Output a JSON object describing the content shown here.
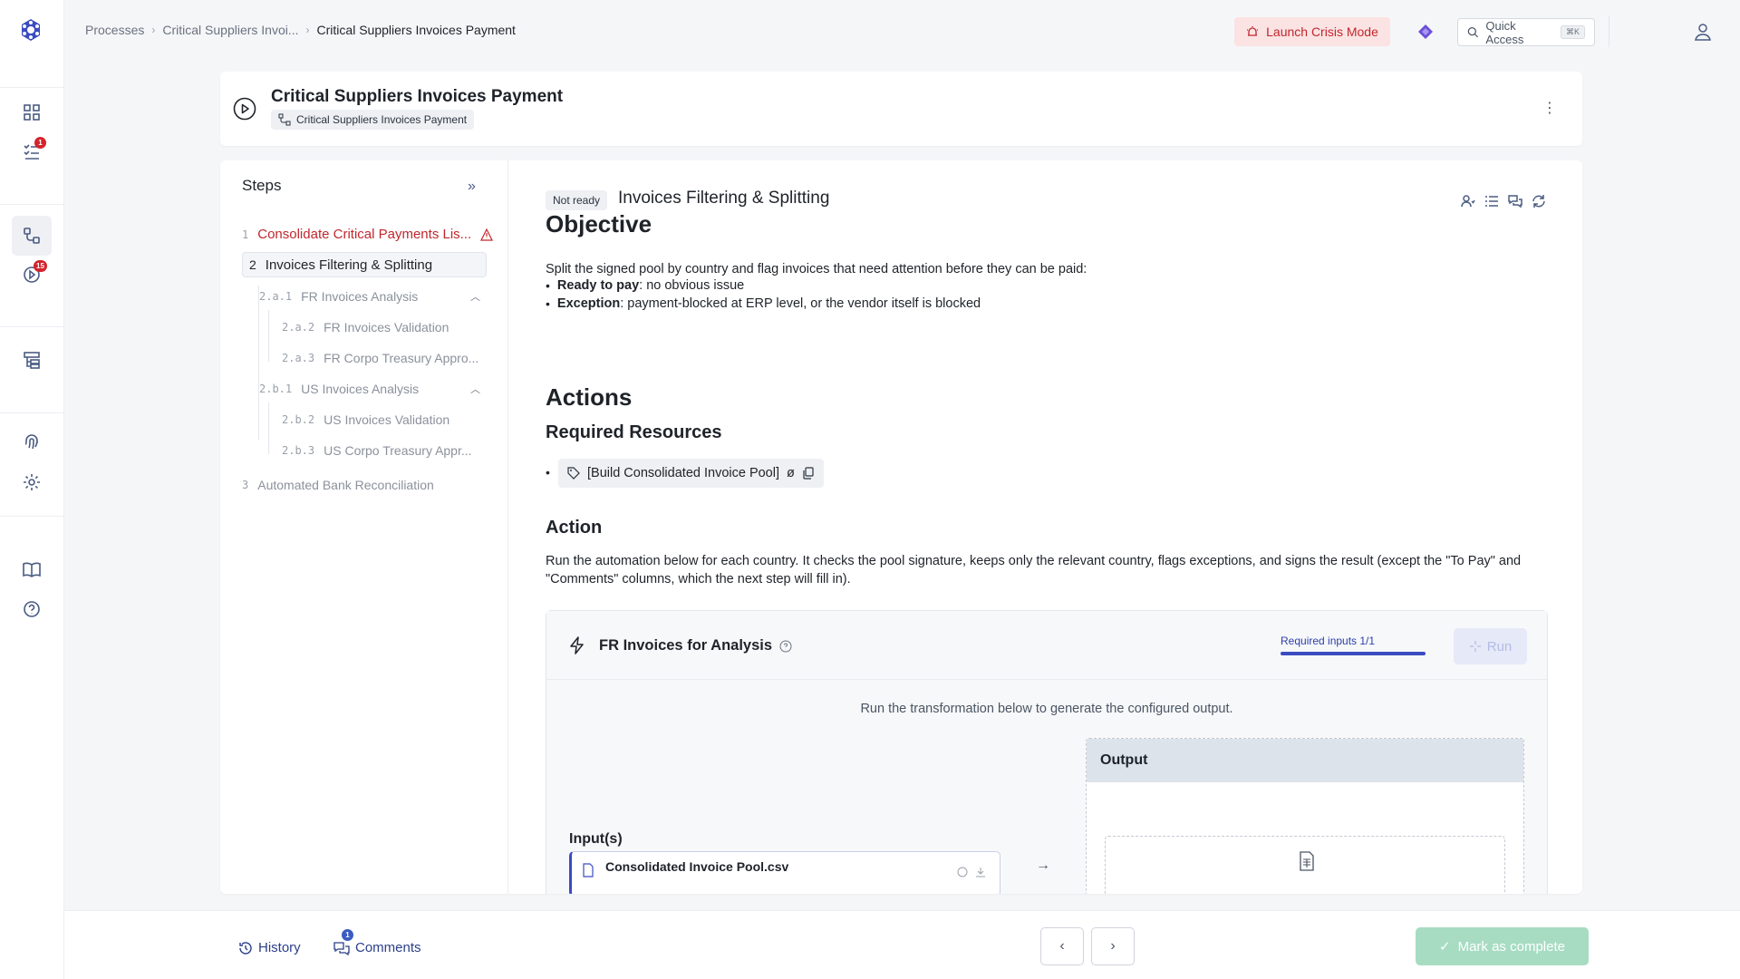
{
  "breadcrumb": {
    "items": [
      "Processes",
      "Critical Suppliers Invoi...",
      "Critical Suppliers Invoices Payment"
    ]
  },
  "topbar": {
    "crisis_label": "Launch Crisis Mode",
    "quick_access_label": "Quick Access",
    "quick_access_shortcut": "⌘K"
  },
  "rail": {
    "tasks_badge": "1",
    "runs_badge": "15"
  },
  "header": {
    "title": "Critical Suppliers Invoices Payment",
    "process_chip": "Critical Suppliers Invoices Payment"
  },
  "steps": {
    "heading": "Steps",
    "items": [
      {
        "num": "1",
        "label": "Consolidate Critical Payments Lis..."
      },
      {
        "num": "2",
        "label": "Invoices Filtering & Splitting"
      },
      {
        "num": "2.a.1",
        "label": "FR Invoices Analysis"
      },
      {
        "num": "2.a.2",
        "label": "FR Invoices Validation"
      },
      {
        "num": "2.a.3",
        "label": "FR Corpo Treasury Appro..."
      },
      {
        "num": "2.b.1",
        "label": "US Invoices Analysis"
      },
      {
        "num": "2.b.2",
        "label": "US Invoices Validation"
      },
      {
        "num": "2.b.3",
        "label": "US Corpo Treasury Appr..."
      },
      {
        "num": "3",
        "label": "Automated Bank Reconciliation"
      }
    ]
  },
  "step_detail": {
    "status": "Not ready",
    "title": "Invoices Filtering & Splitting",
    "objective_heading": "Objective",
    "objective_text": "Split the signed pool by country and flag invoices that need attention before they can be paid:",
    "bullets": [
      {
        "term": "Ready to pay",
        "text": ": no obvious issue"
      },
      {
        "term": "Exception",
        "text": ": payment-blocked at ERP level, or the vendor itself is blocked"
      }
    ],
    "actions_heading": "Actions",
    "required_resources_heading": "Required Resources",
    "resource_chip": "[Build Consolidated Invoice Pool]",
    "resource_symbol": "ø",
    "action_heading": "Action",
    "action_text": "Run the automation below for each country. It checks the pool signature, keeps only the relevant country, flags exceptions, and signs the result (except the \"To Pay\" and \"Comments\" columns, which the next step will fill in)."
  },
  "automation": {
    "title": "FR Invoices for Analysis",
    "required_inputs": "Required inputs 1/1",
    "required_progress": 1.0,
    "run_label": "Run",
    "description": "Run the transformation below to generate the configured output.",
    "inputs_label": "Input(s)",
    "input_file": "Consolidated Invoice Pool.csv",
    "output_label": "Output"
  },
  "footer": {
    "history_label": "History",
    "comments_label": "Comments",
    "comments_badge": "1",
    "complete_label": "Mark as complete"
  },
  "colors": {
    "accent": "#3b4cc0",
    "danger": "#c0272d",
    "success_disabled": "#a7dcc3"
  }
}
